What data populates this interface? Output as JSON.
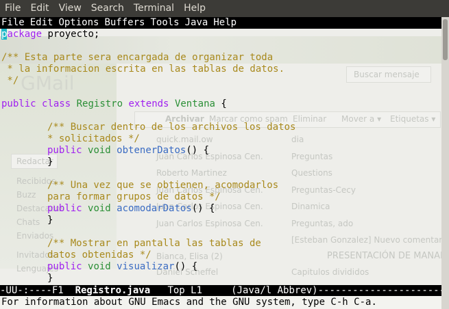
{
  "terminal_menu": [
    "File",
    "Edit",
    "View",
    "Search",
    "Terminal",
    "Help"
  ],
  "emacs_menu": [
    "File",
    "Edit",
    "Options",
    "Buffers",
    "Tools",
    "Java",
    "Help"
  ],
  "code": {
    "l1_kw": "package",
    "l1_rest": " proyecto;",
    "l3": "/** Esta parte sera encargada de organizar toda",
    "l4": " * la informacion escrita en las tablas de datos.",
    "l5": " */",
    "l7_kw1": "public",
    "l7_kw2": "class",
    "l7_name": "Registro",
    "l7_kw3": "extends",
    "l7_super": "Ventana",
    "l7_brace": " {",
    "l9": "/** Buscar dentro de los archivos los datos",
    "l10": "* solicitados */",
    "l11_kw": "public",
    "l11_type": "void",
    "l11_fn": "obtenerDatos",
    "l11_rest": "() {",
    "l12": "}",
    "l14": "/** Una vez que se obtienen, acomodarlos",
    "l15": "para formar grupos de datos */",
    "l16_kw": "public",
    "l16_type": "void",
    "l16_fn": "acomodarDatos",
    "l16_rest": "() {",
    "l17": "}",
    "l19": "/** Mostrar en pantalla las tablas de",
    "l20": "datos obtenidas */",
    "l21_kw": "public",
    "l21_type": "void",
    "l21_fn": "visualizar",
    "l21_rest": "() {",
    "l22": "}"
  },
  "modeline": {
    "status": "-UU-:----F1  ",
    "buffer": "Registro.java",
    "position": "   Top L1     ",
    "mode": "(Java/l Abbrev)",
    "fill": "----------------------------------"
  },
  "echo": "For information about GNU Emacs and the GNU system, type C-h C-a.",
  "ghost_text": {
    "search_button": "Buscar mensaje",
    "gmail_logo": "GMail",
    "archive_button": "Archivar",
    "spam_button": "Marcar como spam",
    "delete_button": "Eliminar",
    "move_button": "Mover a ▾",
    "labels_button": "Etiquetas ▾",
    "compose": "Redactar",
    "sidebar": [
      "Recibidos",
      "Buzz",
      "Destacados",
      "Chats",
      "Enviados",
      "Invitados",
      "Lenguajes"
    ],
    "senders": [
      "quick.mail.ow",
      "Juan Carlos Espinosa Cen.",
      "Roberto Martinez",
      "Juan Carlos Espinosa Cen.",
      "Juan Carlos Espinosa Cen.",
      "Juan Carlos Espinosa Cen.",
      "Bianca, Elisa (2)",
      "Daniel Scheffel"
    ],
    "subjects": [
      "dia",
      "Preguntas",
      "Questions",
      "Preguntas-Cecy",
      "Dinamica",
      "Preguntas, ado",
      "[Esteban Gonzalez] Nuevo comentario",
      "PRESENTACIÓN DE MANAL",
      "Capitulos divididos"
    ]
  }
}
